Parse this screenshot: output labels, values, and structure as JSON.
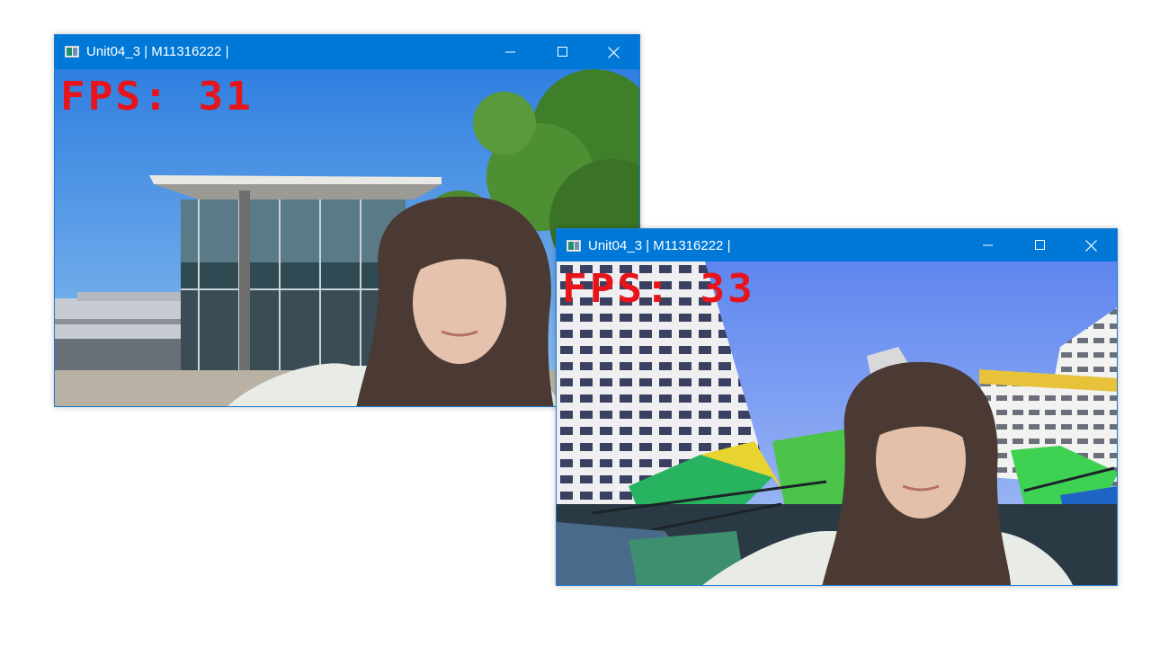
{
  "windows": [
    {
      "title": "Unit04_3 | M11316222 |",
      "fps_text": "FPS: 31",
      "background": "modern glass building with tree and blue sky",
      "fps_color": "#e8141b"
    },
    {
      "title": "Unit04_3 | M11316222 |",
      "fps_text": "FPS: 33",
      "background": "tall white apartment buildings with colorful canopy",
      "fps_color": "#e8141b"
    }
  ],
  "theme": {
    "titlebar_color": "#0078d7",
    "titlebar_text_color": "#ffffff"
  },
  "icons": {
    "minimize": "minimize-icon",
    "maximize": "maximize-icon",
    "close": "close-icon",
    "app": "app-icon"
  }
}
